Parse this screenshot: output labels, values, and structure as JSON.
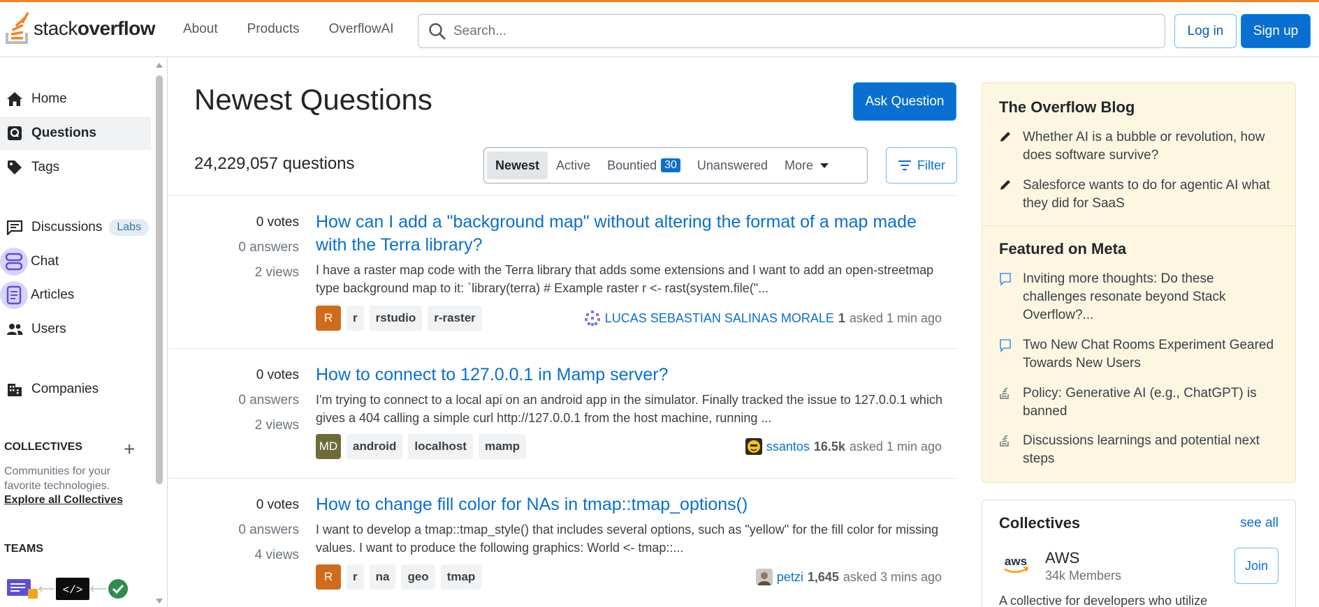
{
  "header": {
    "logo_prefix": "stack",
    "logo_bold": "overflow",
    "nav": [
      "About",
      "Products",
      "OverflowAI"
    ],
    "search_placeholder": "Search...",
    "login": "Log in",
    "signup": "Sign up"
  },
  "sidebar": {
    "items": [
      {
        "label": "Home",
        "icon": "home-icon"
      },
      {
        "label": "Questions",
        "icon": "questions-icon",
        "active": true
      },
      {
        "label": "Tags",
        "icon": "tag-icon"
      },
      {
        "label": "Discussions",
        "icon": "discussions-icon",
        "badge": "Labs"
      },
      {
        "label": "Chat",
        "icon": "chat-icon"
      },
      {
        "label": "Articles",
        "icon": "articles-icon"
      },
      {
        "label": "Users",
        "icon": "users-icon"
      },
      {
        "label": "Companies",
        "icon": "companies-icon"
      }
    ],
    "collectives_heading": "COLLECTIVES",
    "collectives_desc": "Communities for your favorite technologies.",
    "collectives_link": "Explore all Collectives",
    "teams_heading": "TEAMS"
  },
  "main": {
    "title": "Newest Questions",
    "ask_button": "Ask Question",
    "question_count": "24,229,057 questions",
    "tabs": [
      {
        "label": "Newest",
        "active": true
      },
      {
        "label": "Active"
      },
      {
        "label": "Bountied",
        "badge": "30"
      },
      {
        "label": "Unanswered"
      },
      {
        "label": "More"
      }
    ],
    "filter_button": "Filter",
    "questions": [
      {
        "votes": "0 votes",
        "answers": "0 answers",
        "views": "2 views",
        "title": "How can I add a \"background map\" without altering the format of a map made with the Terra library?",
        "excerpt": "I have a raster map code with the Terra library that adds some extensions and I want to add an open-streetmap type background map to it: `library(terra) # Example raster r <- rast(system.file(\"...",
        "avatar_tag": "R",
        "avatar_color": "#cf6b1c",
        "tags": [
          "r",
          "rstudio",
          "r-raster"
        ],
        "user": "LUCAS SEBASTIAN SALINAS MORALE",
        "rep": "1",
        "time": "asked 1 min ago"
      },
      {
        "votes": "0 votes",
        "answers": "0 answers",
        "views": "2 views",
        "title": "How to connect to 127.0.0.1 in Mamp server?",
        "excerpt": "I'm trying to connect to a local api on an android app in the simulator. Finally tracked the issue to 127.0.0.1 which gives a 404 calling a simple curl http://127.0.0.1 from the host machine, running ...",
        "avatar_tag": "MD",
        "avatar_color": "#6f6b38",
        "tags": [
          "android",
          "localhost",
          "mamp"
        ],
        "user": "ssantos",
        "rep": "16.5k",
        "time": "asked 1 min ago"
      },
      {
        "votes": "0 votes",
        "answers": "0 answers",
        "views": "4 views",
        "title": "How to change fill color for NAs in tmap::tmap_options()",
        "excerpt": "I want to develop a tmap::tmap_style() that includes several options, such as \"yellow\" for the fill color for missing values. I want to produce the following graphics: World <- tmap::...",
        "avatar_tag": "R",
        "avatar_color": "#cf6b1c",
        "tags": [
          "r",
          "na",
          "geo",
          "tmap"
        ],
        "user": "petzi",
        "rep": "1,645",
        "time": "asked 3 mins ago"
      }
    ]
  },
  "right": {
    "blog_heading": "The Overflow Blog",
    "blog_items": [
      "Whether AI is a bubble or revolution, how does software survive?",
      "Salesforce wants to do for agentic AI what they did for SaaS"
    ],
    "meta_heading": "Featured on Meta",
    "meta_items": [
      "Inviting more thoughts: Do these challenges resonate beyond Stack Overflow?...",
      "Two New Chat Rooms Experiment Geared Towards New Users",
      "Policy: Generative AI (e.g., ChatGPT) is banned",
      "Discussions learnings and potential next steps"
    ],
    "collectives_heading": "Collectives",
    "see_all": "see all",
    "aws_name": "AWS",
    "aws_members": "34k Members",
    "join": "Join",
    "aws_desc": "A collective for developers who utilize"
  },
  "colors": {
    "accent_orange": "#f48225",
    "link_blue": "#0a6fd0",
    "blog_bg": "#fdf7e2"
  }
}
